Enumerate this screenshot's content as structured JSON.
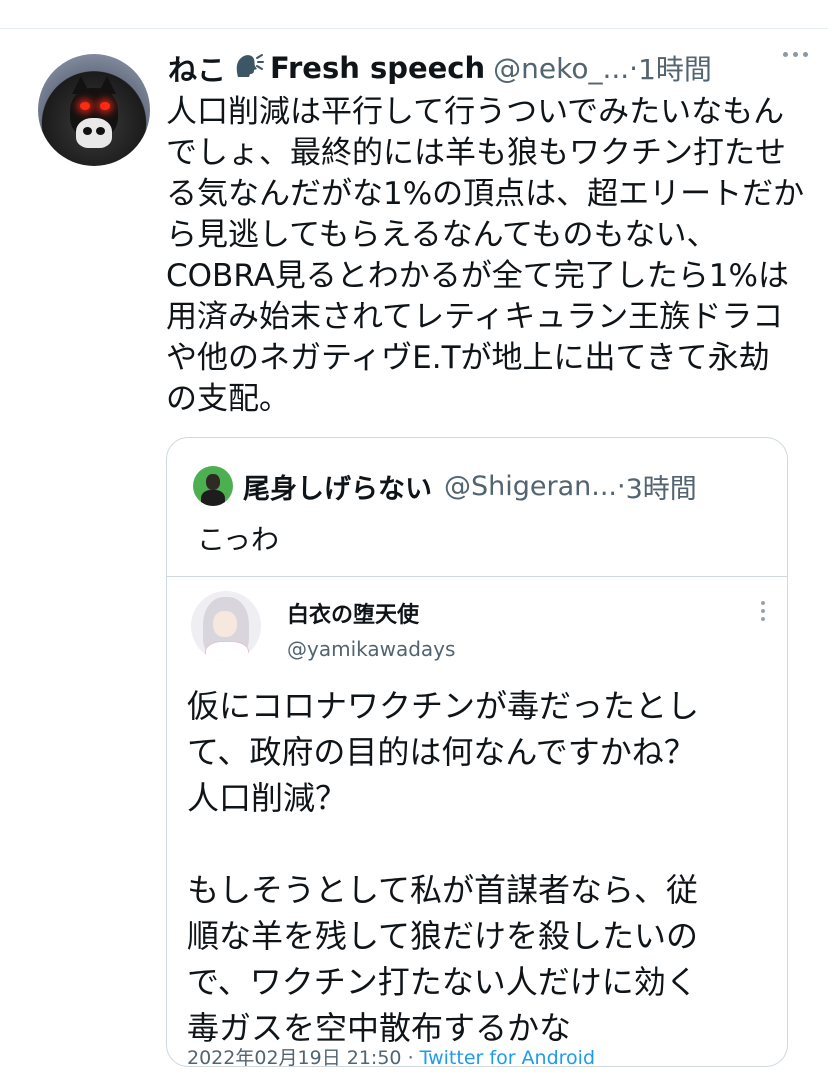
{
  "tweet": {
    "display_name": "ねこ",
    "name_suffix": "Fresh speech",
    "handle": "@neko_...",
    "separator": "·",
    "time": "1時間",
    "icons": {
      "speaking": "speaking-head-icon",
      "more": "more-horizontal-icon",
      "avatar": "cat-skull-avatar"
    },
    "text_lines": [
      "人口削減は平行して行うついでみたいなもん",
      "でしょ、最終的には羊も狼もワクチン打たせ",
      "る気なんだがな1%の頂点は、超エリートだか",
      "ら見逃してもらえるなんてものもない、",
      "COBRA見るとわかるが全て完了したら1%は",
      "用済み始末されてレティキュラン王族ドラコ",
      "や他のネガティヴE.Tが地上に出てきて永劫",
      "の支配。"
    ]
  },
  "quote": {
    "display_name": "尾身しげらない",
    "handle": "@Shigeran...",
    "separator": "·",
    "time": "3時間",
    "text": "こっわ",
    "embedded": {
      "display_name": "白衣の堕天使",
      "handle": "@yamikawadays",
      "text_lines": [
        "仮にコロナワクチンが毒だったとし",
        "て、政府の目的は何なんですかね？",
        "人口削減？",
        "",
        "もしそうとして私が首謀者なら、従",
        "順な羊を残して狼だけを殺したいの",
        "で、ワクチン打たない人だけに効く",
        "毒ガスを空中散布するかな"
      ],
      "date": "2022年02月19日 21:50",
      "separator": "·",
      "source": "Twitter for Android"
    }
  },
  "colors": {
    "text": "#0f1419",
    "secondary": "#536471",
    "border": "#cfd9de",
    "link": "#1d9bf0"
  }
}
